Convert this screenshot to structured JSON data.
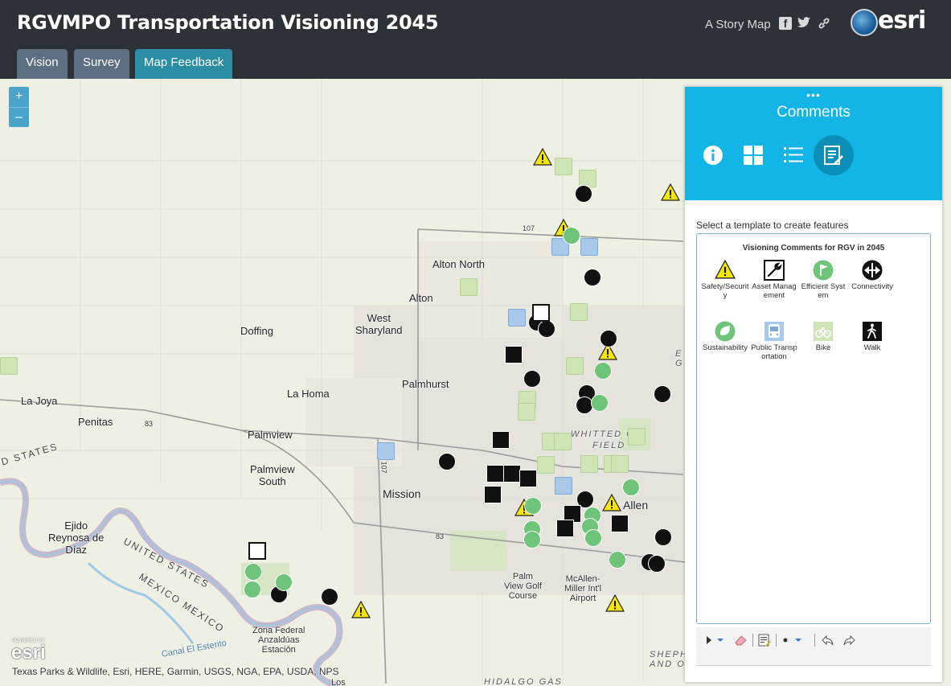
{
  "header": {
    "title": "RGVMPO Transportation Visioning 2045",
    "story_label": "A Story Map",
    "tabs": [
      {
        "label": "Vision"
      },
      {
        "label": "Survey"
      },
      {
        "label": "Map Feedback",
        "active": true
      }
    ],
    "logo_text": "esri"
  },
  "map": {
    "zoom_in": "+",
    "zoom_out": "–",
    "places": {
      "alton_north": "Alton North",
      "alton": "Alton",
      "west_sharyland": "West\nSharyland",
      "doffing": "Doffing",
      "palmhurst": "Palmhurst",
      "la_homa": "La Homa",
      "la_joya": "La Joya",
      "penitas": "Penitas",
      "palmview": "Palmview",
      "palmview_south": "Palmview\nSouth",
      "mission": "Mission",
      "ejido": "Ejido\nReynosa de\nDíaz",
      "united_states_1": "UNITED STATES",
      "united_states_2": "D STATES",
      "mexico": "MEXICO MEXICO",
      "zona_federal": "Zona Federal\nAnzaldúas\nEstación",
      "canal": "Canal El Esterito",
      "whitted": "WHITTED C",
      "field": "FIELD",
      "allen": "Allen",
      "palm_view_golf": "Palm\nView Golf\nCourse",
      "mcallen_airport": "McAllen-\nMiller Int'l\nAirport",
      "hidalgo_gas": "HIDALGO GAS",
      "shephe": "SHEPH\nAND O",
      "edge_e": "E\nG",
      "route_107_a": "107",
      "route_107_b": "107",
      "route_83_a": "83",
      "route_83_b": "83",
      "los": "Los"
    },
    "attribution": "Texas Parks & Wildlife, Esri, HERE, Garmin, USGS, NGA, EPA, USDA, NPS",
    "powered_by": "POWERED BY",
    "powered_esri": "esri"
  },
  "panel": {
    "dots": "•••",
    "title": "Comments",
    "tools": [
      "info-icon",
      "grid-icon",
      "list-icon",
      "edit-icon"
    ],
    "instruction": "Select a template to create features",
    "template_group": "Visioning Comments for RGV in 2045",
    "templates": [
      {
        "label": "Safety/Security",
        "icon": "warning-icon"
      },
      {
        "label": "Asset Management",
        "icon": "wrench-icon"
      },
      {
        "label": "Efficient System",
        "icon": "flag-icon"
      },
      {
        "label": "Connectivity",
        "icon": "arrows-icon"
      },
      {
        "label": "Sustainability",
        "icon": "leaf-icon"
      },
      {
        "label": "Public Transportation",
        "icon": "bus-icon"
      },
      {
        "label": "Bike",
        "icon": "bike-icon"
      },
      {
        "label": "Walk",
        "icon": "walk-icon"
      }
    ]
  },
  "colors": {
    "header_bg": "#2c3238",
    "tab_bg": "#5d6f80",
    "tab_active": "#2b8ea4",
    "panel_accent": "#12b5e6",
    "efficient_green": "#6ec479",
    "bike_green": "#cfe5b5",
    "bus_blue": "#a9c9ea",
    "warning_yellow": "#f7e600"
  }
}
